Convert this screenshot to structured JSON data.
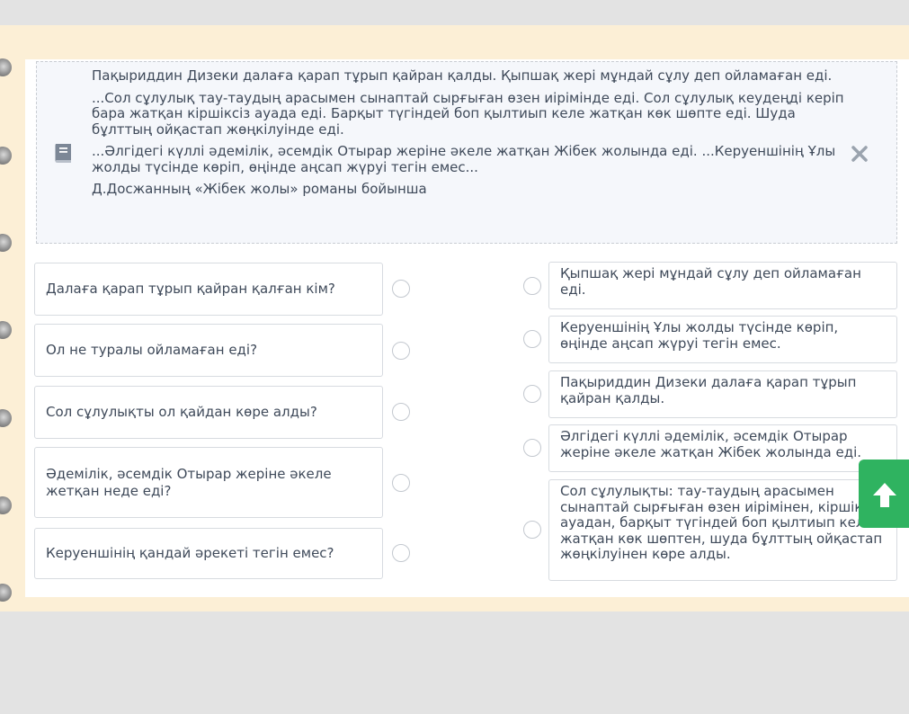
{
  "passage": {
    "paragraphs": [
      "Пақыриддин Дизеки далаға қарап тұрып қайран қалды. Қыпшақ жері мұндай сұлу деп ойламаған еді.",
      "...Сол сұлулық тау-таудың арасымен сынаптай сырғыған өзен иірімінде еді. Сол сұлулық кеудеңді керіп бара жатқан кіршіксіз ауада еді. Барқыт түгіндей боп қылтиып келе жатқан көк шөпте еді. Шуда бұлттың ойқастап жөңкілуінде еді.",
      "...Әлгідегі күллі әдемілік, әсемдік Отырар жеріне әкеле жатқан Жібек жолында еді. ...Керуеншінің Ұлы жолды түсінде көріп, өңінде аңсап жүруі тегін емес..."
    ],
    "source": "Д.Досжанның «Жібек жолы» романы бойынша",
    "icon": "book-icon",
    "close_icon": "close-icon"
  },
  "questions": [
    "Далаға қарап тұрып қайран қалған кім?",
    "Ол не туралы ойламаған еді?",
    "Сол сұлулықты ол қайдан көре алды?",
    "Әдемілік, әсемдік Отырар жеріне әкеле жетқан неде еді?",
    "Керуеншінің қандай әрекеті тегін емес?"
  ],
  "answers": [
    "Қыпшақ жері мұндай сұлу деп ойламаған еді.",
    "Керуеншінің Ұлы жолды түсінде көріп, өңінде аңсап жүруі тегін емес.",
    "Пақыриддин Дизеки далаға қарап тұрып қайран қалды.",
    "Әлгідегі күллі әдемілік, әсемдік Отырар жеріне әкеле жатқан Жібек жолында еді.",
    "Сол сұлулықты: тау-таудың арасымен сынаптай сырғыған өзен иірімінен, кіршіксіз ауадан, барқыт түгіндей боп қылтиып келе жатқан көк шөптен, шуда бұлттың ойқастап жөңкілуінен көре алды."
  ],
  "colors": {
    "accent_green": "#2fb360",
    "paper": "#fcefd6",
    "text": "#3f4a5a"
  },
  "scroll_up_icon": "arrow-up-icon"
}
